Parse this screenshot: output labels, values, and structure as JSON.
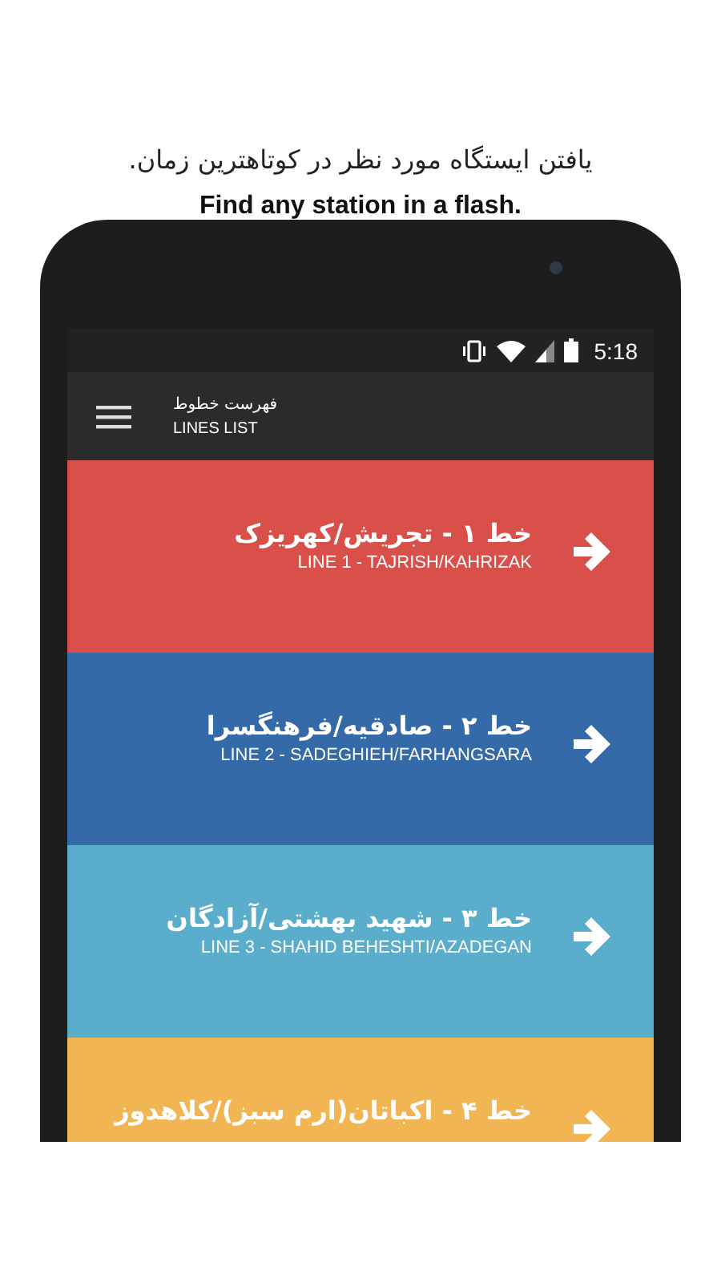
{
  "caption": {
    "persian": "یافتن ایستگاه مورد نظر در کوتاهترین زمان.",
    "english": "Find any station in a flash."
  },
  "status_bar": {
    "time": "5:18"
  },
  "app_bar": {
    "title": "فهرست خطوط",
    "subtitle": "LINES LIST"
  },
  "lines": [
    {
      "title": "خط ۱ - تجریش/کهریزک",
      "subtitle": "LINE 1 - TAJRISH/KAHRIZAK",
      "color": "#d94f4a"
    },
    {
      "title": "خط ۲ - صادقیه/فرهنگسرا",
      "subtitle": "LINE 2 - SADEGHIEH/FARHANGSARA",
      "color": "#356aa8"
    },
    {
      "title": "خط ۳ - شهید بهشتی/آزادگان",
      "subtitle": "LINE 3 - SHAHID BEHESHTI/AZADEGAN",
      "color": "#5badcc"
    },
    {
      "title": "خط ۴ - اکباتان(ارم سبز)/کلاهدوز",
      "color": "#f2b553"
    }
  ]
}
